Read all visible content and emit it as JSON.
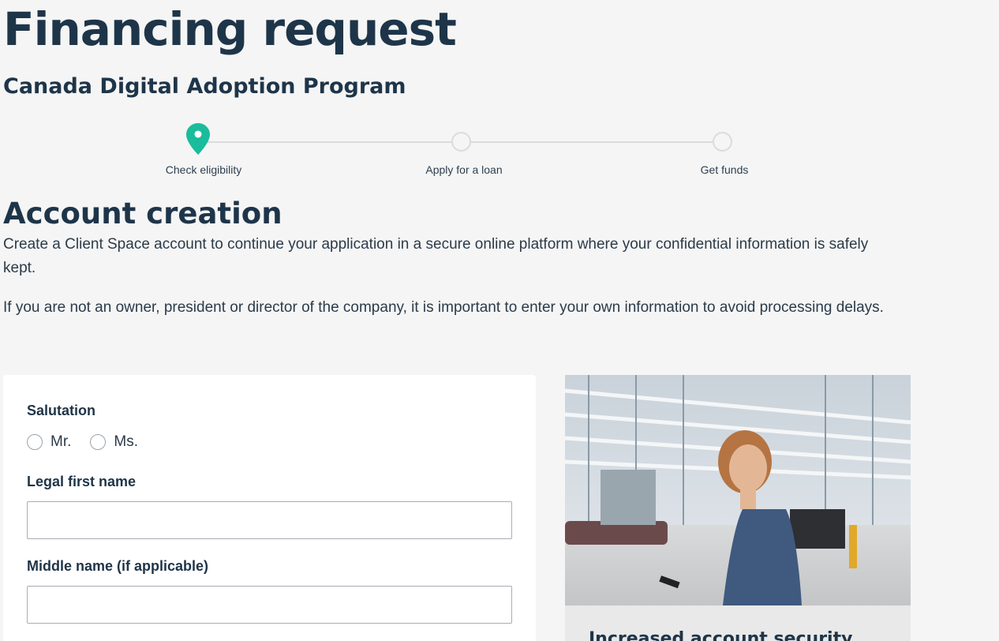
{
  "header": {
    "title": "Financing request",
    "subtitle": "Canada Digital Adoption Program"
  },
  "stepper": {
    "steps": [
      {
        "label": "Check eligibility",
        "state": "current"
      },
      {
        "label": "Apply for a loan",
        "state": "upcoming"
      },
      {
        "label": "Get funds",
        "state": "upcoming"
      }
    ],
    "accent_color": "#1abc9c"
  },
  "account_creation": {
    "title": "Account creation",
    "paragraph_1": "Create a Client Space account to continue your application in a secure online platform where your confidential information is safely kept.",
    "paragraph_2": "If you are not an owner, president or director of the company, it is important to enter your own information to avoid processing delays."
  },
  "form": {
    "salutation_label": "Salutation",
    "salutation_options": [
      "Mr.",
      "Ms."
    ],
    "first_name_label": "Legal first name",
    "first_name_value": "",
    "middle_name_label": "Middle name (if applicable)",
    "middle_name_value": ""
  },
  "side_card": {
    "image_icon": "warehouse-woman-photo",
    "heading": "Increased account security"
  }
}
